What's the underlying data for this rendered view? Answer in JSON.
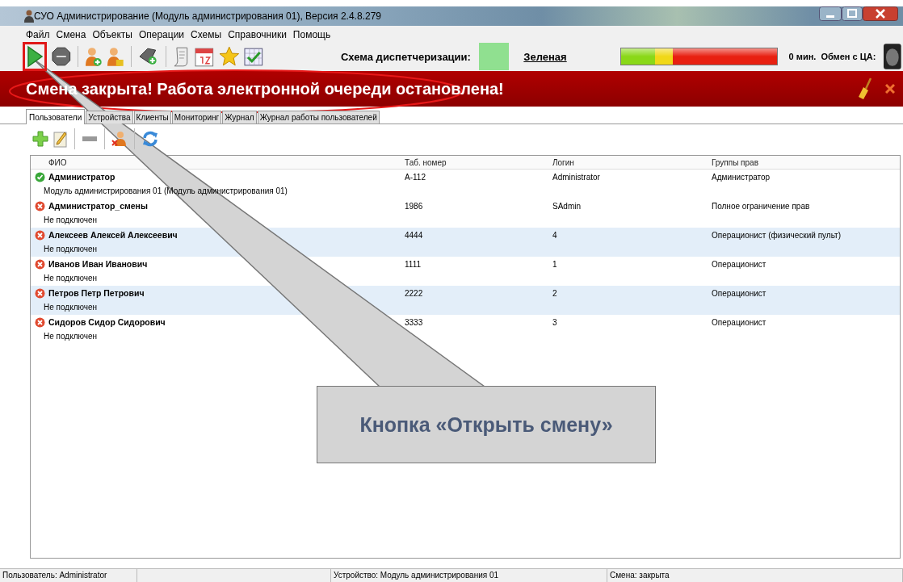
{
  "window": {
    "title": "СУО Администрирование (Модуль администрирования 01), Версия 2.4.8.279"
  },
  "menu": [
    "Файл",
    "Смена",
    "Объекты",
    "Операции",
    "Схемы",
    "Справочники",
    "Помощь"
  ],
  "toolbar": {
    "dispatch_label": "Схема диспетчеризации:",
    "scheme_name": "Зеленая",
    "wait_time": "0 мин.",
    "exchange_label": "Обмен с ЦА:"
  },
  "banner": {
    "text": "Смена закрыта! Работа электронной очереди остановлена!"
  },
  "tabs": [
    {
      "label": "Пользователи",
      "selected": true
    },
    {
      "label": "Устройства",
      "selected": false
    },
    {
      "label": "Клиенты",
      "selected": false
    },
    {
      "label": "Мониторинг",
      "selected": false
    },
    {
      "label": "Журнал",
      "selected": false
    },
    {
      "label": "Журнал работы пользователей",
      "selected": false
    }
  ],
  "table": {
    "columns": [
      "ФИО",
      "Таб. номер",
      "Логин",
      "Группы прав"
    ],
    "rows": [
      {
        "online": true,
        "name": "Администратор",
        "subtitle": "Модуль администрирования 01 (Модуль администрирования 01)",
        "number": "A-112",
        "login": "Administrator",
        "groups": "Администратор"
      },
      {
        "online": false,
        "name": "Администратор_смены",
        "subtitle": "Не подключен",
        "number": "1986",
        "login": "SAdmin",
        "groups": "Полное ограничение прав"
      },
      {
        "online": false,
        "name": "Алексеев Алексей  Алексеевич",
        "subtitle": "Не подключен",
        "number": "4444",
        "login": "4",
        "groups": "Операционист (физический пульт)"
      },
      {
        "online": false,
        "name": "Иванов Иван  Иванович",
        "subtitle": "Не подключен",
        "number": "1111",
        "login": "1",
        "groups": "Операционист"
      },
      {
        "online": false,
        "name": "Петров Петр  Петрович",
        "subtitle": "Не подключен",
        "number": "2222",
        "login": "2",
        "groups": "Операционист"
      },
      {
        "online": false,
        "name": "Сидоров Сидор  Сидорович",
        "subtitle": "Не подключен",
        "number": "3333",
        "login": "3",
        "groups": "Операционист"
      }
    ]
  },
  "status_bar": [
    "Пользователь: Administrator",
    "Устройство: Модуль администрирования 01",
    "Смена: закрыта"
  ],
  "callout": {
    "text": "Кнопка «Открыть смену»"
  }
}
